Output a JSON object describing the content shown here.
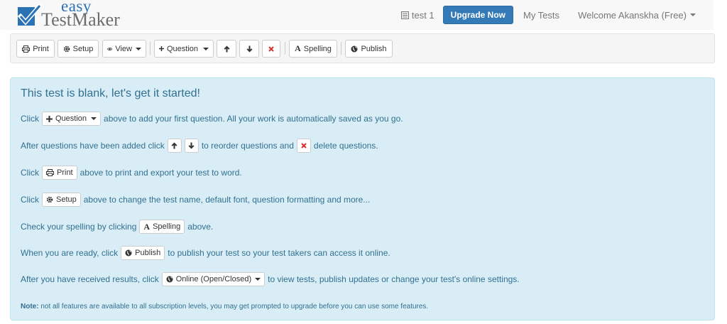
{
  "header": {
    "logo_top": "easy",
    "logo_bottom": "TestMaker",
    "test_name": "test 1",
    "upgrade_label": "Upgrade Now",
    "my_tests_label": "My Tests",
    "welcome_label": "Welcome Akanskha (Free)"
  },
  "toolbar": {
    "print_label": "Print",
    "setup_label": "Setup",
    "view_label": "View",
    "question_label": "Question",
    "spelling_label": "Spelling",
    "publish_label": "Publish"
  },
  "panel": {
    "title": "This test is blank, let's get it started!",
    "line1_pre": "Click",
    "line1_btn": "Question",
    "line1_post": "above to add your first question. All your work is automatically saved as you go.",
    "line2_pre": "After questions have been added click",
    "line2_mid": "to reorder questions and",
    "line2_post": "delete questions.",
    "line3_pre": "Click",
    "line3_btn": "Print",
    "line3_post": "above to print and export your test to word.",
    "line4_pre": "Click",
    "line4_btn": "Setup",
    "line4_post": "above to change the test name, default font, question formatting and more...",
    "line5_pre": "Check your spelling by clicking",
    "line5_btn": "Spelling",
    "line5_post": "above.",
    "line6_pre": "When you are ready, click",
    "line6_btn": "Publish",
    "line6_post": "to publish your test so your test takers can access it online.",
    "line7_pre": "After you have received results, click",
    "line7_btn": "Online (Open/Closed)",
    "line7_post": "to view tests, publish updates or change your test's online settings.",
    "note_bold": "Note:",
    "note_text": "not all features are available to all subscription levels, you may get prompted to upgrade before you can use some features."
  },
  "colors": {
    "brand_blue": "#337ab7",
    "panel_bg": "#d9edf7",
    "panel_text": "#31708f",
    "delete_red": "#d9302c",
    "logo_check": "#2b72b5"
  }
}
